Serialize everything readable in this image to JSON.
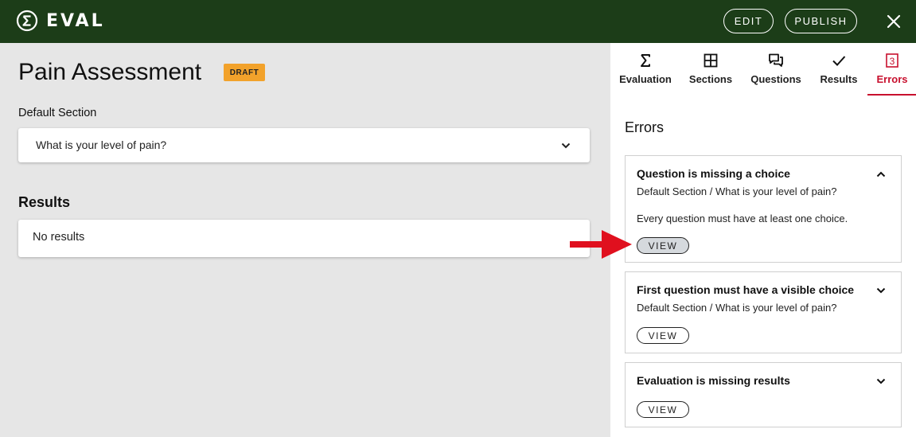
{
  "app": {
    "logo_text": "EVAL",
    "edit_label": "EDIT",
    "publish_label": "PUBLISH"
  },
  "main": {
    "title": "Pain Assessment",
    "status_badge": "DRAFT",
    "section_label": "Default Section",
    "question": "What is your level of pain?",
    "results_heading": "Results",
    "no_results": "No results"
  },
  "panel": {
    "tabs": [
      {
        "label": "Evaluation",
        "icon": "sigma-icon"
      },
      {
        "label": "Sections",
        "icon": "grid-icon"
      },
      {
        "label": "Questions",
        "icon": "chat-icon"
      },
      {
        "label": "Results",
        "icon": "check-icon"
      },
      {
        "label": "Errors",
        "icon": "error-count-icon",
        "count": "3",
        "active": true
      }
    ],
    "heading": "Errors",
    "errors": [
      {
        "title": "Question is missing a choice",
        "path": "Default Section / What is your level of pain?",
        "description": "Every question must have at least one choice.",
        "view_label": "VIEW",
        "expanded": true
      },
      {
        "title": "First question must have a visible choice",
        "path": "Default Section / What is your level of pain?",
        "view_label": "VIEW",
        "expanded": false
      },
      {
        "title": "Evaluation is missing results",
        "view_label": "VIEW",
        "expanded": false
      }
    ]
  },
  "colors": {
    "topbar": "#1c3d18",
    "badge": "#f2a22b",
    "accent_red": "#c8102e",
    "arrow": "#e0101e"
  }
}
